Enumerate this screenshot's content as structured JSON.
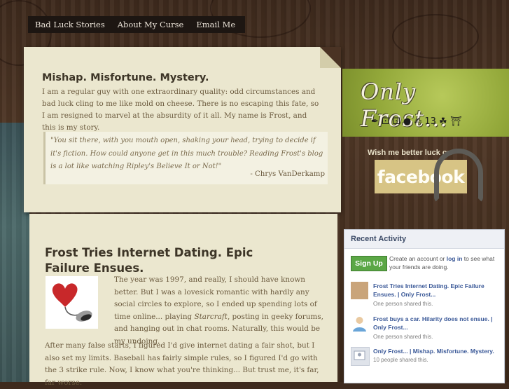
{
  "nav": {
    "items": [
      "Bad Luck Stories",
      "About My Curse",
      "Email Me"
    ]
  },
  "intro": {
    "title": "Mishap. Misfortune. Mystery.",
    "text": "I am a regular guy with one extraordinary quality: odd circumstances and bad luck cling to me like mold on cheese. There is no escaping this fate, so I am resigned to marvel at the absurdity of it all. My name is Frost, and this is my story.",
    "quote": "\"You sit there, with you mouth open, shaking your head, trying to decide if it's fiction. How could anyone get in this much trouble? Reading Frost's blog is a lot like watching Ripley's Believe It or Not!\"",
    "quote_author": "- Chrys VanDerkamp"
  },
  "sidebar": {
    "logo_text": "Only Frost...",
    "charms": "✒ ⚀ ⚀ ● ✍ 13 ☘ ⛩",
    "wish_text": "Wish me better luck on",
    "facebook_label": "facebook"
  },
  "article": {
    "title": "Frost Tries Internet Dating. Epic Failure Ensues.",
    "p1_before": "The year was 1997, and really, I should have known better. But I was a lovesick romantic with hardly any social circles to explore, so I ended up spending lots of time online... playing ",
    "p1_game": "Starcraft",
    "p1_after": ", posting in geeky forums, and hanging out in chat rooms. Naturally, this would be my undoing.",
    "p2": "After many false starts, I figured I'd give internet dating a fair shot, but I also set my limits. Baseball has fairly simple rules, so I figured I'd go with the 3 strike rule. Now, I know what you're thinking... But trust me, it's far, far worse."
  },
  "activity": {
    "header": "Recent Activity",
    "signup_label": "Sign Up",
    "create_before": "Create an account or ",
    "login_label": "log in",
    "create_after": " to see what your friends are doing.",
    "items": [
      {
        "title": "Frost Tries Internet Dating. Epic Failure Ensues. | Only Frost...",
        "shared": "One person shared this."
      },
      {
        "title": "Frost buys a car. Hilarity does not ensue. | Only Frost...",
        "shared": "One person shared this."
      },
      {
        "title": "Only Frost... | Mishap. Misfortune. Mystery.",
        "shared": "10 people shared this."
      }
    ]
  }
}
